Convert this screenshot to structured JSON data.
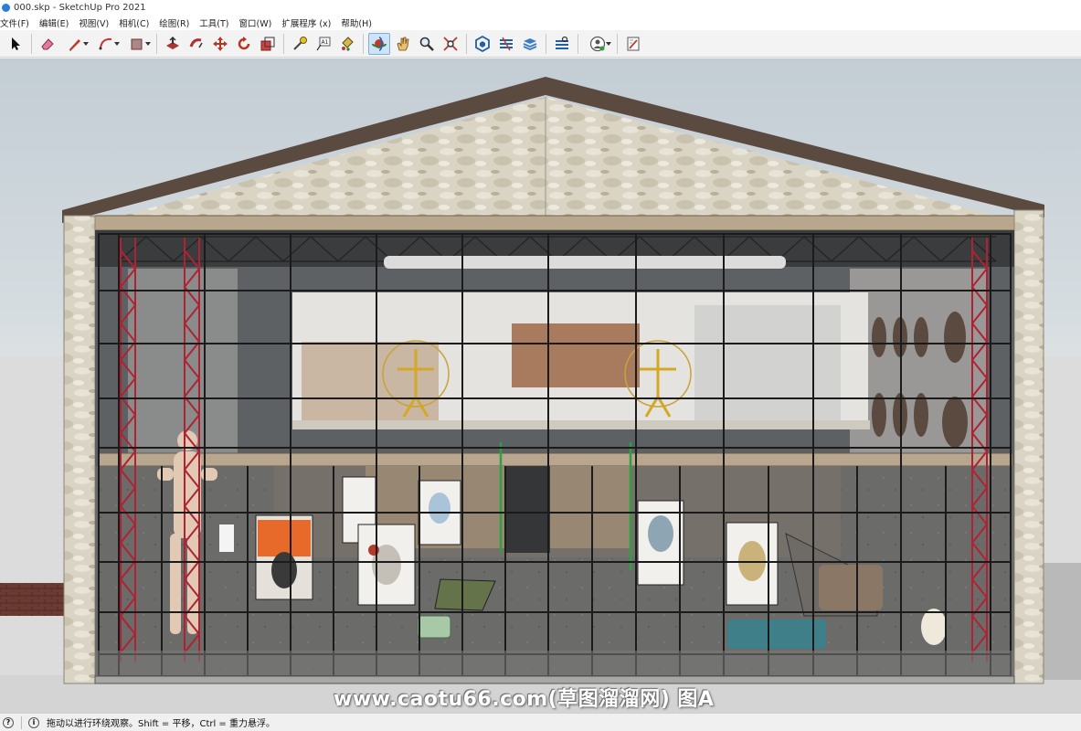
{
  "window": {
    "title": "000.skp - SketchUp Pro 2021"
  },
  "menu": {
    "items": [
      "文件(F)",
      "编辑(E)",
      "视图(V)",
      "相机(C)",
      "绘图(R)",
      "工具(T)",
      "窗口(W)",
      "扩展程序 (x)",
      "帮助(H)"
    ]
  },
  "toolbar": {
    "tools": [
      {
        "name": "select-tool",
        "icon": "arrow-cursor-icon"
      },
      {
        "name": "eraser-tool",
        "icon": "eraser-icon"
      },
      {
        "name": "line-tool",
        "icon": "pencil-icon"
      },
      {
        "name": "arc-tool",
        "icon": "arc-icon"
      },
      {
        "name": "shape-tool",
        "icon": "rectangle-icon"
      },
      {
        "name": "push-pull-tool",
        "icon": "push-pull-icon"
      },
      {
        "name": "follow-me-tool",
        "icon": "follow-me-icon"
      },
      {
        "name": "move-tool",
        "icon": "move-icon"
      },
      {
        "name": "rotate-tool",
        "icon": "rotate-icon"
      },
      {
        "name": "scale-tool",
        "icon": "scale-icon"
      },
      {
        "name": "tape-measure-tool",
        "icon": "tape-measure-icon"
      },
      {
        "name": "text-tool",
        "icon": "text-icon"
      },
      {
        "name": "paint-bucket-tool",
        "icon": "paint-bucket-icon"
      },
      {
        "name": "orbit-tool",
        "icon": "orbit-icon"
      },
      {
        "name": "pan-tool",
        "icon": "hand-icon"
      },
      {
        "name": "zoom-tool",
        "icon": "magnifier-icon"
      },
      {
        "name": "zoom-extents-tool",
        "icon": "zoom-extents-icon"
      },
      {
        "name": "3d-warehouse",
        "icon": "warehouse-icon"
      },
      {
        "name": "extension-warehouse",
        "icon": "extension-warehouse-icon"
      },
      {
        "name": "layout-send",
        "icon": "layout-icon"
      },
      {
        "name": "extension-manager",
        "icon": "extension-manager-icon"
      },
      {
        "name": "account",
        "icon": "user-account-icon"
      },
      {
        "name": "report-problem",
        "icon": "report-icon"
      }
    ],
    "accent": "#2a7fd4"
  },
  "viewport": {
    "watermark": "www.caotu66.com(草图溜溜网) 图A"
  },
  "status": {
    "text": "拖动以进行环绕观察。Shift = 平移，Ctrl = 重力悬浮。",
    "icon_1": "geo-location-icon",
    "icon_2": "info-icon"
  }
}
